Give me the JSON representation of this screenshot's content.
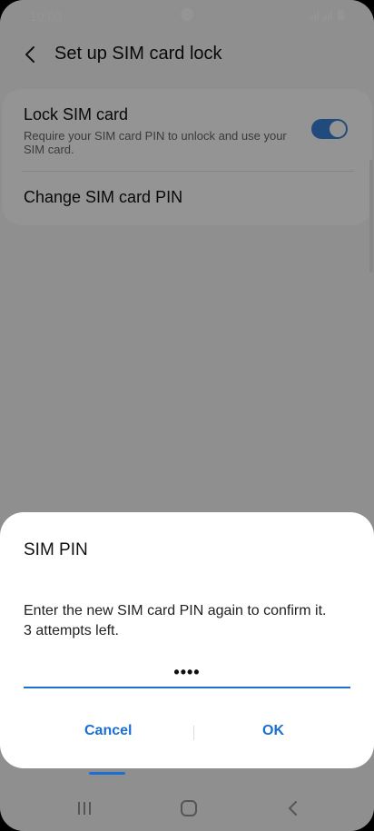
{
  "status_bar": {
    "time": "10:00"
  },
  "header": {
    "title": "Set up SIM card lock"
  },
  "settings": {
    "lock_sim": {
      "title": "Lock SIM card",
      "subtitle": "Require your SIM card PIN to unlock and use your SIM card.",
      "enabled": true
    },
    "change_pin": {
      "title": "Change SIM card PIN"
    }
  },
  "dialog": {
    "title": "SIM PIN",
    "message_line1": "Enter the new SIM card PIN again to confirm it.",
    "message_line2": "3 attempts left.",
    "pin_value": "••••",
    "cancel_label": "Cancel",
    "ok_label": "OK"
  },
  "colors": {
    "accent": "#1a6fd1",
    "toggle_on": "#3b82d8"
  },
  "nav_bar": {
    "recents_icon": "recents-icon",
    "home_icon": "home-icon",
    "back_icon": "back-icon"
  }
}
